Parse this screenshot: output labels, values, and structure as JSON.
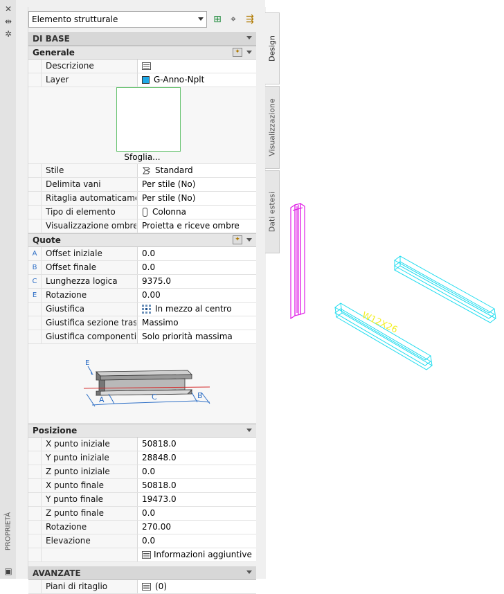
{
  "title_strip": {
    "close_glyph": "✕",
    "autohide_glyph": "⇹",
    "options_glyph": "✲",
    "title": "PROPRIETÀ",
    "bottom_glyph": "▣"
  },
  "selector": {
    "value": "Elemento strutturale"
  },
  "toolbar": {
    "add_glyph": "⊞",
    "pick_glyph": "⌖",
    "quick_select_glyph": "⇶"
  },
  "sections": {
    "base": "DI BASE",
    "generale": "Generale",
    "quote": "Quote",
    "posizione": "Posizione",
    "avanzate": "AVANZATE"
  },
  "generale": {
    "descrizione": {
      "label": "Descrizione",
      "value": ""
    },
    "layer": {
      "label": "Layer",
      "value": "G-Anno-Nplt"
    },
    "preview_caption": "Sfoglia...",
    "stile": {
      "label": "Stile",
      "value": "Standard"
    },
    "delimita": {
      "label": "Delimita vani",
      "value": "Per stile (No)"
    },
    "ritaglia": {
      "label": "Ritaglia automaticame...",
      "value": "Per stile (No)"
    },
    "tipo": {
      "label": "Tipo di elemento",
      "value": "Colonna"
    },
    "ombre": {
      "label": "Visualizzazione ombre",
      "value": "Proietta e riceve ombre"
    }
  },
  "quote": {
    "offset_iniziale": {
      "key": "A",
      "label": "Offset iniziale",
      "value": "0.0"
    },
    "offset_finale": {
      "key": "B",
      "label": "Offset finale",
      "value": "0.0"
    },
    "lunghezza": {
      "key": "C",
      "label": "Lunghezza logica",
      "value": "9375.0"
    },
    "rotazione": {
      "key": "E",
      "label": "Rotazione",
      "value": "0.00"
    },
    "giustifica": {
      "label": "Giustifica",
      "value": "In mezzo al centro"
    },
    "giustifica_sezione": {
      "label": "Giustifica  sezione  trasv...",
      "value": "Massimo"
    },
    "giustifica_componenti": {
      "label": "Giustifica componenti",
      "value": "Solo priorità massima"
    },
    "diagram_labels": {
      "a": "A",
      "b": "B",
      "c": "C",
      "e": "E"
    }
  },
  "posizione": {
    "x_iniziale": {
      "label": "X punto iniziale",
      "value": "50818.0"
    },
    "y_iniziale": {
      "label": "Y punto iniziale",
      "value": "28848.0"
    },
    "z_iniziale": {
      "label": "Z punto iniziale",
      "value": "0.0"
    },
    "x_finale": {
      "label": "X punto finale",
      "value": "50818.0"
    },
    "y_finale": {
      "label": "Y punto finale",
      "value": "19473.0"
    },
    "z_finale": {
      "label": "Z punto finale",
      "value": "0.0"
    },
    "rotazione": {
      "label": "Rotazione",
      "value": "270.00"
    },
    "elevazione": {
      "label": "Elevazione",
      "value": "0.0"
    },
    "info": {
      "value": "Informazioni aggiuntive"
    }
  },
  "avanzate": {
    "piani": {
      "label": "Piani di ritaglio",
      "value": "(0)"
    }
  },
  "tabs": {
    "design": "Design",
    "visualizzazione": "Visualizzazione",
    "dati_estesi": "Dati estesi"
  },
  "drawing": {
    "beam_label": "W12X26"
  },
  "colors": {
    "column": "#e01ee6",
    "beam": "#1fdcef",
    "label": "#f2ef2c",
    "layer_swatch": "#1fa9e6"
  }
}
